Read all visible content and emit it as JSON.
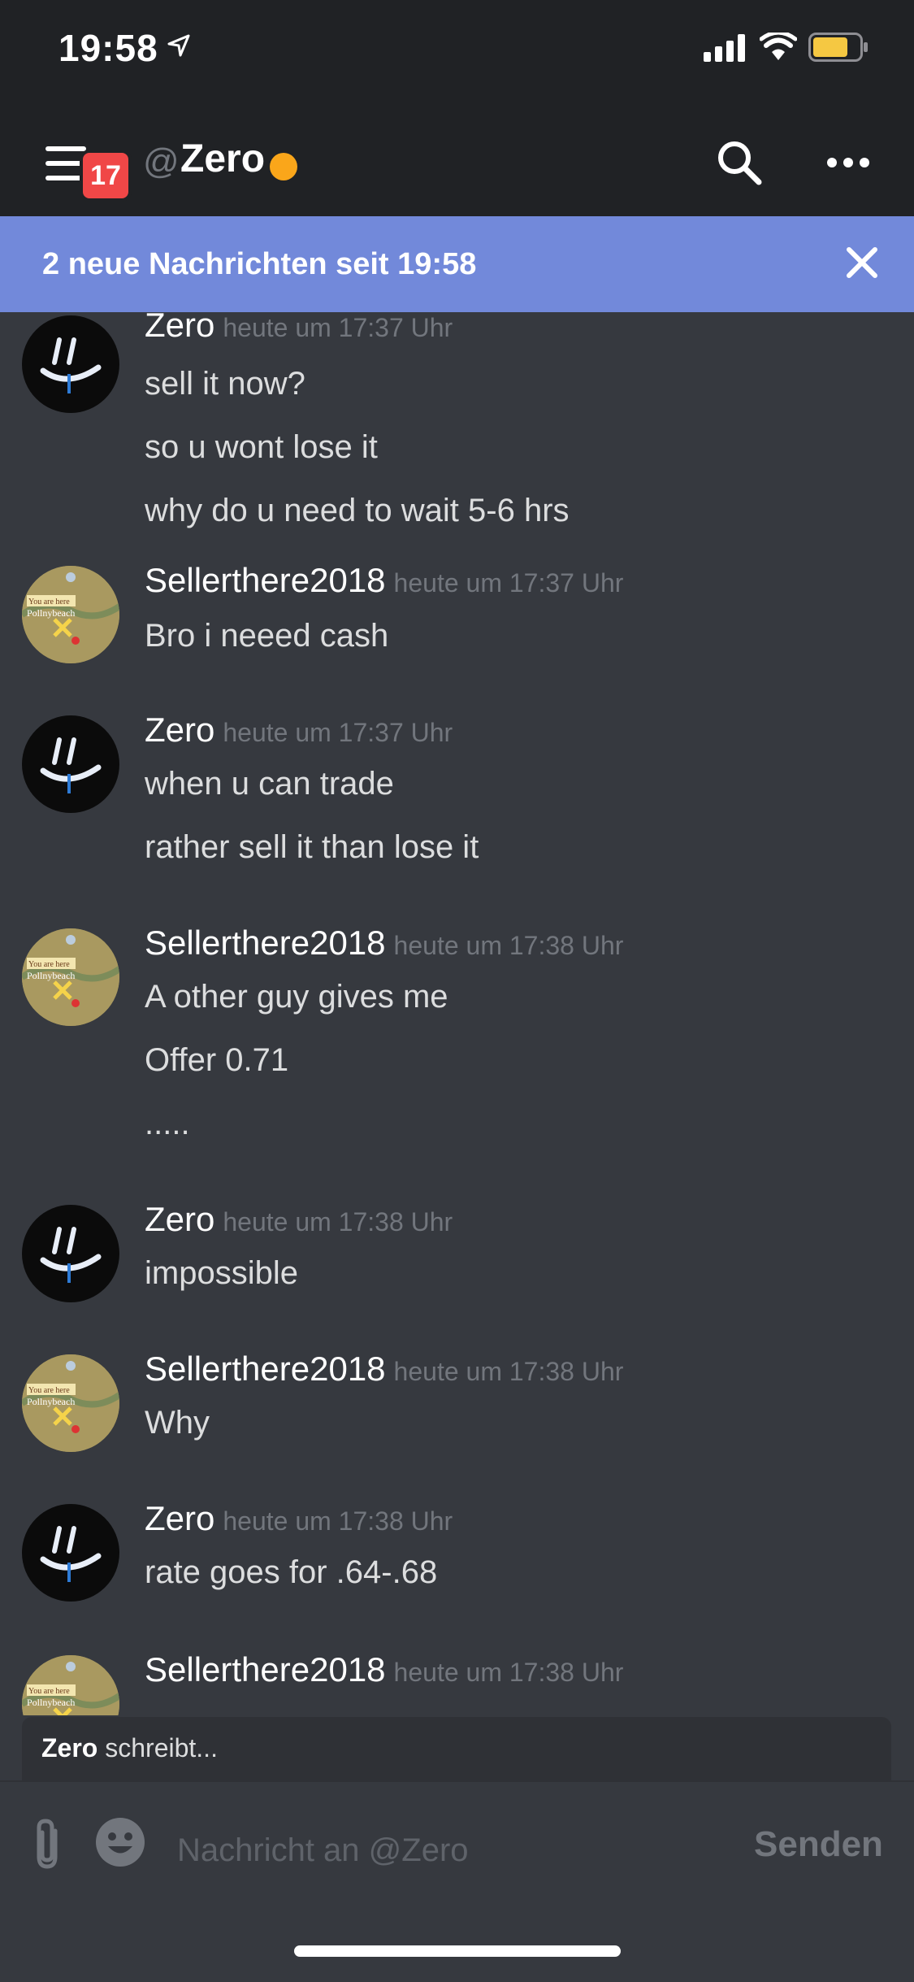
{
  "status_bar": {
    "time": "19:58",
    "icons": [
      "location-arrow-icon",
      "signal-icon",
      "wifi-icon",
      "battery-icon"
    ]
  },
  "header": {
    "unread_badge": "17",
    "at_symbol": "@",
    "channel_name": "Zero",
    "presence_color": "#faa61a",
    "icons": [
      "menu-icon",
      "search-icon",
      "more-icon"
    ]
  },
  "banner": {
    "text": "2 neue Nachrichten seit 19:58",
    "icon": "close-icon"
  },
  "messages": [
    {
      "author": "Zero",
      "timestamp": "heute um 17:37 Uhr",
      "avatar": "zero",
      "lines": [
        "sell it now?",
        "so u wont lose it",
        "why do u need to wait 5-6 hrs"
      ]
    },
    {
      "author": "Sellerthere2018",
      "timestamp": "heute um 17:37 Uhr",
      "avatar": "seller",
      "lines": [
        "Bro i neeed cash"
      ]
    },
    {
      "author": "Zero",
      "timestamp": "heute um 17:37 Uhr",
      "avatar": "zero",
      "lines": [
        "when u can trade",
        "rather sell it than lose it"
      ]
    },
    {
      "author": "Sellerthere2018",
      "timestamp": "heute um 17:38 Uhr",
      "avatar": "seller",
      "lines": [
        "A other guy gives me",
        "Offer 0.71",
        "....."
      ]
    },
    {
      "author": "Zero",
      "timestamp": "heute um 17:38 Uhr",
      "avatar": "zero",
      "lines": [
        "impossible"
      ]
    },
    {
      "author": "Sellerthere2018",
      "timestamp": "heute um 17:38 Uhr",
      "avatar": "seller",
      "lines": [
        "Why"
      ]
    },
    {
      "author": "Zero",
      "timestamp": "heute um 17:38 Uhr",
      "avatar": "zero",
      "lines": [
        "rate goes for .64-.68"
      ]
    },
    {
      "author": "Sellerthere2018",
      "timestamp": "heute um 17:38 Uhr",
      "avatar": "seller",
      "lines": []
    }
  ],
  "avatar_art": {
    "seller_label_1": "You are here",
    "seller_label_2": "Pollnybeach"
  },
  "typing": {
    "user": "Zero",
    "text": " schreibt..."
  },
  "composer": {
    "placeholder": "Nachricht an @Zero",
    "send_label": "Senden",
    "icons": [
      "attach-icon",
      "emoji-icon"
    ]
  },
  "colors": {
    "accent_banner": "#7289da",
    "badge": "#f04747",
    "background": "#36393f",
    "header": "#202225"
  }
}
